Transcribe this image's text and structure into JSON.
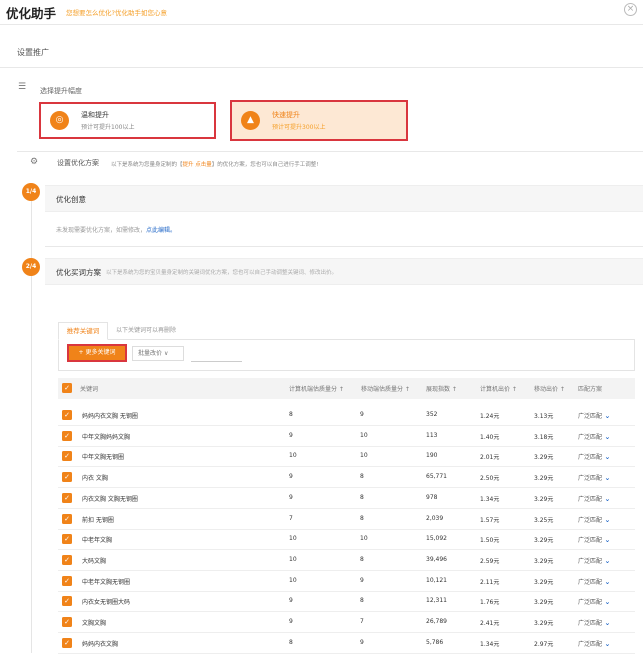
{
  "header": {
    "title": "优化助手",
    "subtitle": "您想要怎么优化?优化助手如您心意",
    "close_icon": "×"
  },
  "section_title": "设置推广",
  "select": {
    "label": "选择提升幅度",
    "options": [
      {
        "name": "温和提升",
        "desc": "预计可提升100以上"
      },
      {
        "name": "快速提升",
        "desc": "预计可提升300以上"
      }
    ]
  },
  "plan": {
    "label": "设置优化方案",
    "desc_prefix": "以下是系统为您量身定制的【",
    "desc_highlight": "提升 点击量",
    "desc_suffix": "】的优化方案，您也可以自己进行手工调整!"
  },
  "step1": {
    "badge": "1/4",
    "title": "优化创意",
    "note": "未发现需要优化方案，如需修改，",
    "note_link": "点此编辑。"
  },
  "step2": {
    "badge": "2/4",
    "title": "优化买词方案",
    "desc": "以下是系统为您的宝贝量身定制的关键词优化方案，您也可以自己手动调整关键词、修改出价。"
  },
  "tabs": {
    "active": "推荐关键词",
    "other": "以下关键词可以再删除"
  },
  "toolbar": {
    "more_keywords": "+ 更多关键词",
    "bulk_bid": "批量改价"
  },
  "table": {
    "columns": [
      "关键词",
      "计算机端估质量分 ↑",
      "移动端估质量分 ↑",
      "展现指数 ↑",
      "计算机出价 ↑",
      "移动出价 ↑",
      "匹配方案"
    ],
    "rows": [
      [
        "妈妈内衣文胸 无钢圈",
        "8",
        "9",
        "352",
        "1.24元",
        "3.13元",
        "广泛匹配"
      ],
      [
        "中年文胸妈妈文胸",
        "9",
        "10",
        "113",
        "1.40元",
        "3.18元",
        "广泛匹配"
      ],
      [
        "中年文胸无钢圈",
        "10",
        "10",
        "190",
        "2.01元",
        "3.29元",
        "广泛匹配"
      ],
      [
        "内衣 文胸",
        "9",
        "8",
        "65,771",
        "2.50元",
        "3.29元",
        "广泛匹配"
      ],
      [
        "内衣文胸 文胸无钢圈",
        "9",
        "8",
        "978",
        "1.34元",
        "3.29元",
        "广泛匹配"
      ],
      [
        "前扣 无钢圈",
        "7",
        "8",
        "2,039",
        "1.57元",
        "3.25元",
        "广泛匹配"
      ],
      [
        "中老年文胸",
        "10",
        "10",
        "15,092",
        "1.50元",
        "3.29元",
        "广泛匹配"
      ],
      [
        "大码文胸",
        "10",
        "8",
        "39,496",
        "2.59元",
        "3.29元",
        "广泛匹配"
      ],
      [
        "中老年文胸无钢圈",
        "10",
        "9",
        "10,121",
        "2.11元",
        "3.29元",
        "广泛匹配"
      ],
      [
        "内衣女无钢圈大码",
        "9",
        "8",
        "12,311",
        "1.76元",
        "3.29元",
        "广泛匹配"
      ],
      [
        "文胸文胸",
        "9",
        "7",
        "26,789",
        "2.41元",
        "3.29元",
        "广泛匹配"
      ],
      [
        "妈妈内衣文胸",
        "8",
        "9",
        "5,786",
        "1.34元",
        "2.97元",
        "广泛匹配"
      ]
    ]
  },
  "colors": {
    "accent": "#f08319",
    "highlight_border": "#d9363e",
    "link": "#2469c8"
  }
}
